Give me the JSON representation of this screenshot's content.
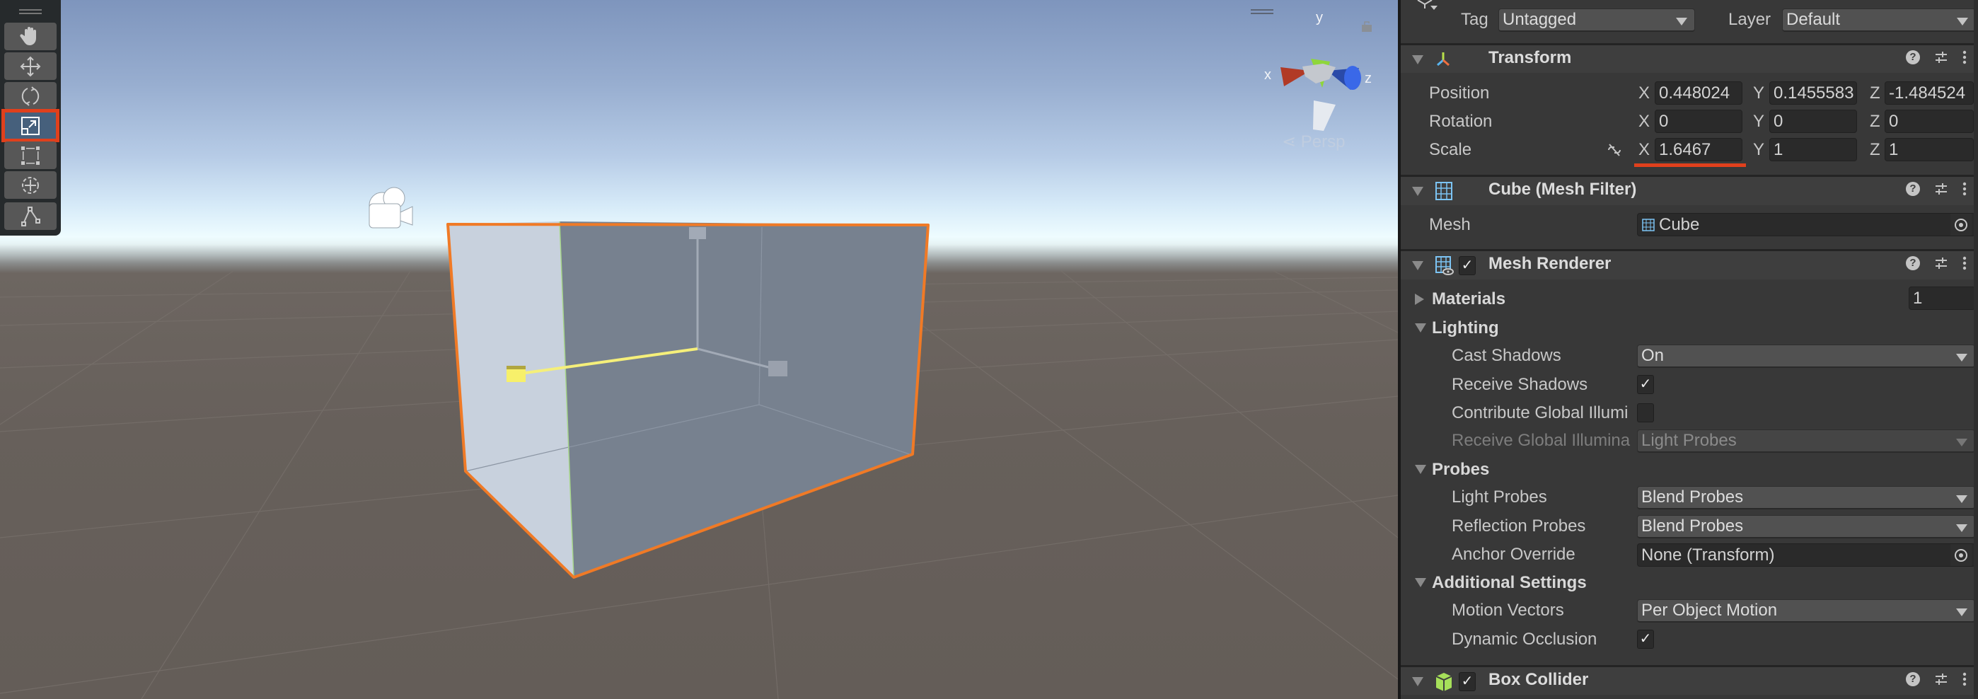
{
  "scene": {
    "view_mode": "Persp",
    "gizmo_axes": {
      "x": "x",
      "y": "y",
      "z": "z"
    },
    "axis_colors": {
      "x": "#b13a26",
      "y": "#8fd63a",
      "z": "#3a68e8"
    },
    "selection_outline_color": "#f07a26",
    "active_tool": "scale-tool"
  },
  "toolbar": {
    "tools": [
      {
        "name": "hand-tool",
        "icon": "hand-icon",
        "active": false
      },
      {
        "name": "move-tool",
        "icon": "move-arrows-icon",
        "active": false
      },
      {
        "name": "rotate-tool",
        "icon": "rotate-icon",
        "active": false
      },
      {
        "name": "scale-tool",
        "icon": "scale-icon",
        "active": true
      },
      {
        "name": "rect-tool",
        "icon": "rect-transform-icon",
        "active": false
      },
      {
        "name": "transform-tool",
        "icon": "transform-icon",
        "active": false
      },
      {
        "name": "custom-tool",
        "icon": "custom-editor-tool-icon",
        "active": false
      }
    ]
  },
  "inspector": {
    "tag_label": "Tag",
    "tag_value": "Untagged",
    "layer_label": "Layer",
    "layer_value": "Default",
    "transform": {
      "title": "Transform",
      "position": {
        "label": "Position",
        "x": "0.448024",
        "y": "0.1455583",
        "z": "-1.484524"
      },
      "rotation": {
        "label": "Rotation",
        "x": "0",
        "y": "0",
        "z": "0"
      },
      "scale": {
        "label": "Scale",
        "x": "1.6467",
        "y": "1",
        "z": "1"
      },
      "axis_labels": {
        "x": "X",
        "y": "Y",
        "z": "Z"
      }
    },
    "mesh_filter": {
      "title": "Cube (Mesh Filter)",
      "mesh_label": "Mesh",
      "mesh_value": "Cube"
    },
    "mesh_renderer": {
      "title": "Mesh Renderer",
      "enabled": true,
      "materials_label": "Materials",
      "materials_count": "1",
      "lighting_label": "Lighting",
      "cast_shadows_label": "Cast Shadows",
      "cast_shadows_value": "On",
      "receive_shadows_label": "Receive Shadows",
      "receive_shadows": true,
      "contribute_gi_label": "Contribute Global Illumi",
      "contribute_gi": false,
      "receive_gi_label": "Receive Global Illumina",
      "receive_gi_value": "Light Probes",
      "probes_label": "Probes",
      "light_probes_label": "Light Probes",
      "light_probes_value": "Blend Probes",
      "reflection_probes_label": "Reflection Probes",
      "reflection_probes_value": "Blend Probes",
      "anchor_override_label": "Anchor Override",
      "anchor_override_value": "None (Transform)",
      "additional_settings_label": "Additional Settings",
      "motion_vectors_label": "Motion Vectors",
      "motion_vectors_value": "Per Object Motion",
      "dynamic_occlusion_label": "Dynamic Occlusion",
      "dynamic_occlusion": true
    },
    "box_collider": {
      "title": "Box Collider",
      "enabled": true
    },
    "check_glyph": "✓",
    "help_glyph": "?"
  }
}
